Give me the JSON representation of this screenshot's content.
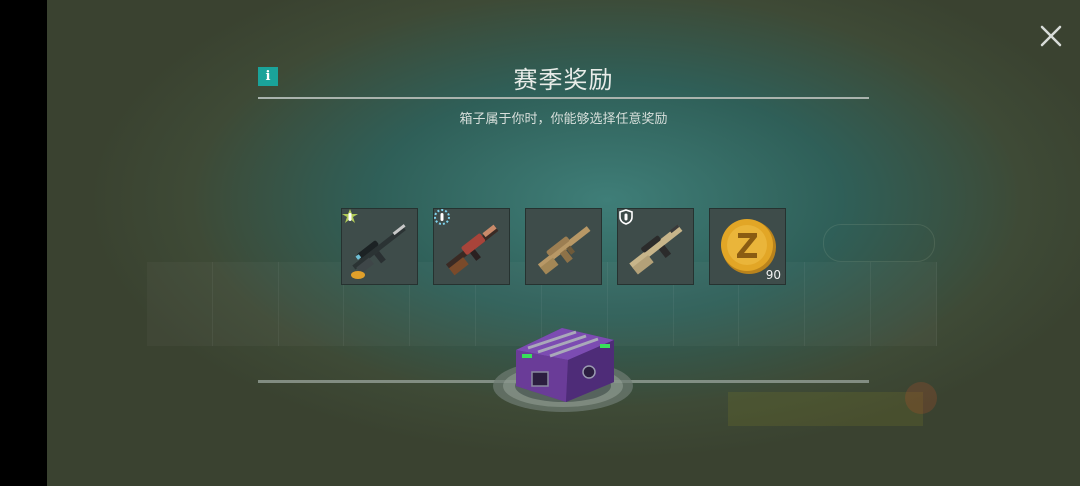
{
  "popup": {
    "title": "赛季奖励",
    "subtitle": "箱子属于你时，你能够选择任意奖励"
  },
  "rewards": [
    {
      "name": "sniper-rifle",
      "tag": "rarity-bullet-icon",
      "tag_color": "#c7e35a"
    },
    {
      "name": "shotgun",
      "tag": "rarity-bullet-icon",
      "tag_color": "#7fd3ee"
    },
    {
      "name": "assault-rifle",
      "tag": null
    },
    {
      "name": "bullpup-rifle",
      "tag": "shield-icon",
      "tag_color": "#ffffff"
    },
    {
      "name": "gold-coin",
      "quantity": "90"
    }
  ],
  "colors": {
    "accent_teal": "#1aa39a",
    "chest_purple": "#6a3c98",
    "chest_green": "#38e05a",
    "coin_gold": "#e2a626"
  }
}
